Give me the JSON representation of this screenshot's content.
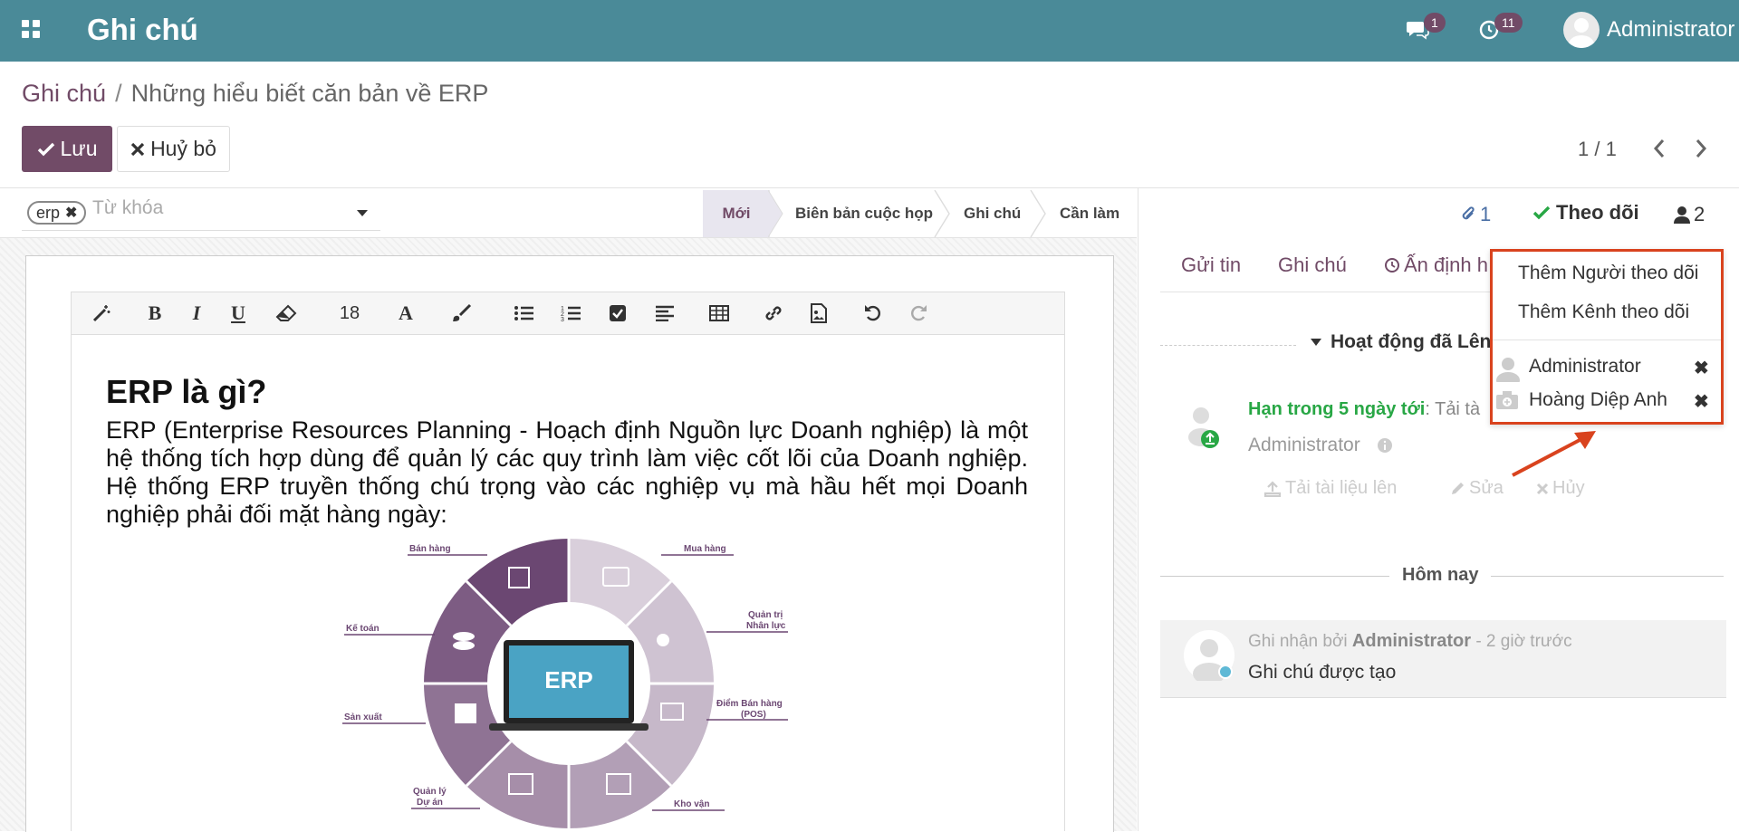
{
  "navbar": {
    "app_title": "Ghi chú",
    "messages_badge": "1",
    "activities_badge": "11",
    "user_name": "Administrator",
    "bg_color": "#4a8a98"
  },
  "breadcrumb": {
    "root": "Ghi chú",
    "separator": "/",
    "current": "Những hiểu biết căn bản về ERP"
  },
  "actions": {
    "save_label": "Lưu",
    "discard_label": "Huỷ bỏ"
  },
  "pager": {
    "value": "1 / 1"
  },
  "tags": {
    "chip": "erp",
    "placeholder": "Từ khóa"
  },
  "stages": [
    "Mới",
    "Biên bản cuộc họp",
    "Ghi chú",
    "Cần làm"
  ],
  "toolbar": {
    "font_size": "18"
  },
  "content": {
    "heading": "ERP là gì?",
    "paragraph": "ERP (Enterprise Resources Planning - Hoạch định Nguồn lực Doanh nghiệp) là một hệ thống tích hợp dùng để quản lý các quy trình làm việc cốt lõi của Doanh nghiệp. Hệ thống ERP truyền thống chú trọng vào các nghiệp vụ mà hầu hết mọi Doanh nghiệp phải đối mặt hàng ngày:"
  },
  "erp_diagram": {
    "center": "ERP",
    "labels": [
      "Bán hàng",
      "Mua hàng",
      "Quản trị",
      "Nhân lực",
      "Kế toán",
      "Điểm Bán hàng",
      "(POS)",
      "Sản xuất",
      "Quản lý",
      "Dự án",
      "Kho vận"
    ]
  },
  "chatter": {
    "attachments": "1",
    "follow_label": "Theo dõi",
    "followers_count": "2",
    "tabs": [
      "Gửi tin",
      "Ghi chú",
      "Ấn định h"
    ],
    "activity_header": "Hoạt động đã Lên",
    "activity": {
      "due": "Hạn trong 5 ngày tới",
      "due_rest": ": Tải tà",
      "user": "Administrator",
      "upload": "Tải tài liệu lên",
      "edit": "Sửa",
      "cancel": "Hủy"
    },
    "today_label": "Hôm nay",
    "message": {
      "prefix": "Ghi nhận bởi",
      "author": "Administrator",
      "time": "- 2 giờ trước",
      "body": "Ghi chú được tạo"
    }
  },
  "followers_dropdown": {
    "add_follower": "Thêm Người theo dõi",
    "add_channel": "Thêm Kênh theo dõi",
    "followers": [
      "Administrator",
      "Hoàng Diệp Anh"
    ]
  }
}
